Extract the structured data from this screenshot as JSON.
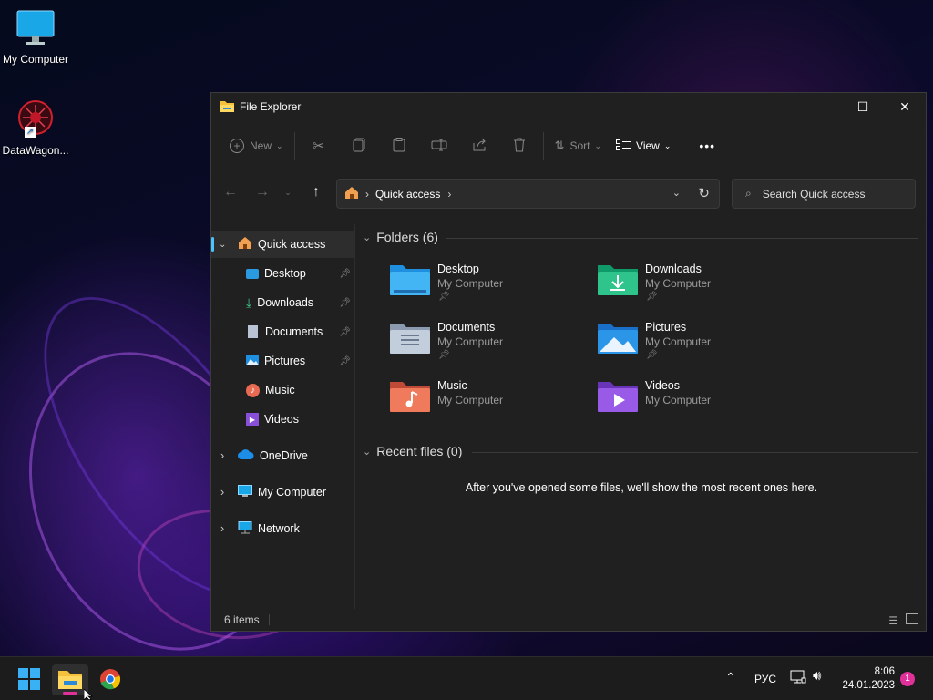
{
  "desktop": {
    "icons": [
      {
        "label": "My Computer"
      },
      {
        "label": "DataWagon..."
      }
    ]
  },
  "window": {
    "title": "File Explorer",
    "controls": {
      "minimize": "—",
      "maximize": "☐",
      "close": "✕"
    },
    "toolbar": {
      "new_label": "New",
      "sort_label": "Sort",
      "view_label": "View",
      "more_label": "•••"
    },
    "address": {
      "home": "",
      "crumb": "Quick access"
    },
    "search": {
      "placeholder": "Search Quick access"
    },
    "sidebar": {
      "quick_access": "Quick access",
      "pinned": [
        {
          "label": "Desktop",
          "pinned": true
        },
        {
          "label": "Downloads",
          "pinned": true
        },
        {
          "label": "Documents",
          "pinned": true
        },
        {
          "label": "Pictures",
          "pinned": true
        },
        {
          "label": "Music",
          "pinned": false
        },
        {
          "label": "Videos",
          "pinned": false
        }
      ],
      "onedrive": "OneDrive",
      "my_computer": "My Computer",
      "network": "Network"
    },
    "main": {
      "folders_header": "Folders (6)",
      "folders": [
        {
          "name": "Desktop",
          "location": "My Computer",
          "pinned": true
        },
        {
          "name": "Downloads",
          "location": "My Computer",
          "pinned": true
        },
        {
          "name": "Documents",
          "location": "My Computer",
          "pinned": true
        },
        {
          "name": "Pictures",
          "location": "My Computer",
          "pinned": true
        },
        {
          "name": "Music",
          "location": "My Computer",
          "pinned": false
        },
        {
          "name": "Videos",
          "location": "My Computer",
          "pinned": false
        }
      ],
      "recent_header": "Recent files (0)",
      "recent_empty": "After you've opened some files, we'll show the most recent ones here."
    },
    "status": {
      "items": "6 items"
    }
  },
  "taskbar": {
    "language": "РУС",
    "time": "8:06",
    "date": "24.01.2023",
    "notification_count": "1"
  },
  "colors": {
    "accent": "#4cc2ff",
    "window_bg": "#202020",
    "taskbar_bg": "#1c1c1c",
    "notification_badge": "#e0309a"
  }
}
